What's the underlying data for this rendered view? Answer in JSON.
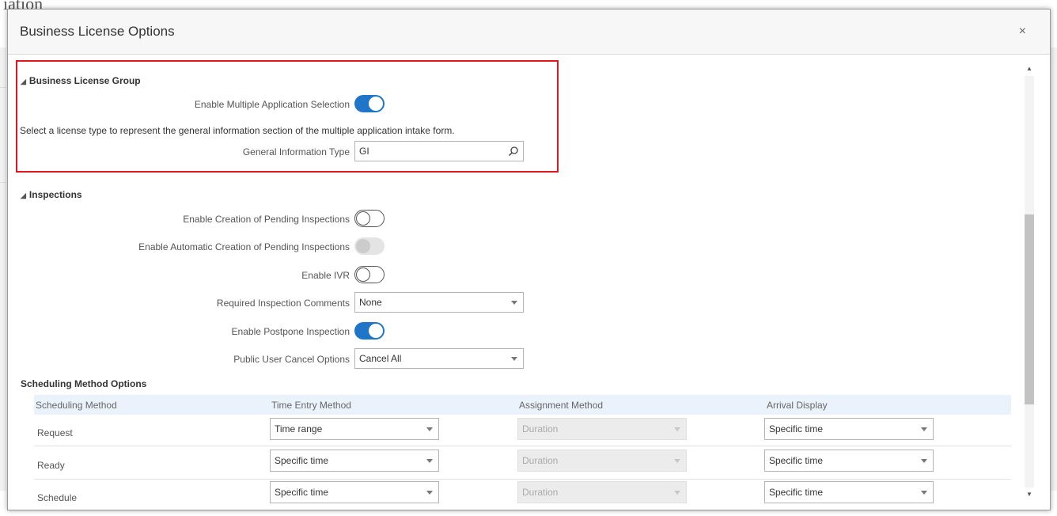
{
  "background": {
    "title_fragment": "iation"
  },
  "dialog": {
    "title": "Business License Options",
    "close_glyph": "×"
  },
  "business_license_group": {
    "heading": "Business License Group",
    "enable_multiple_label": "Enable Multiple Application Selection",
    "enable_multiple_value": true,
    "help_text": "Select a license type to represent the general information section of the multiple application intake form.",
    "general_info_label": "General Information Type",
    "general_info_value": "GI"
  },
  "inspections": {
    "heading": "Inspections",
    "pending_label": "Enable Creation of Pending Inspections",
    "pending_value": false,
    "auto_pending_label": "Enable Automatic Creation of Pending Inspections",
    "auto_pending_value": false,
    "ivr_label": "Enable IVR",
    "ivr_value": false,
    "comments_label": "Required Inspection Comments",
    "comments_value": "None",
    "postpone_label": "Enable Postpone Inspection",
    "postpone_value": true,
    "cancel_label": "Public User Cancel Options",
    "cancel_value": "Cancel All"
  },
  "scheduling": {
    "heading": "Scheduling Method Options",
    "columns": [
      "Scheduling Method",
      "Time Entry Method",
      "Assignment Method",
      "Arrival Display"
    ],
    "rows": [
      {
        "method": "Request",
        "time_entry": "Time range",
        "assignment": "Duration",
        "arrival": "Specific time"
      },
      {
        "method": "Ready",
        "time_entry": "Specific time",
        "assignment": "Duration",
        "arrival": "Specific time"
      },
      {
        "method": "Schedule",
        "time_entry": "Specific time",
        "assignment": "Duration",
        "arrival": "Specific time"
      }
    ]
  },
  "colors": {
    "accent": "#1f75c7",
    "highlight": "#e0171d",
    "grid_header": "#eaf3fb"
  },
  "icons": {
    "search": "magnifier-icon",
    "close": "close-icon",
    "collapse": "triangle-down-icon"
  }
}
